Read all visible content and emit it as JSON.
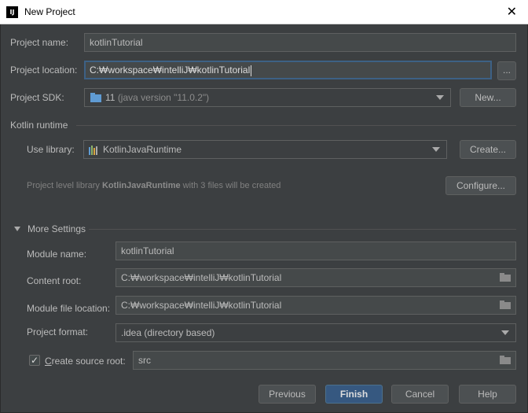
{
  "window": {
    "title": "New Project",
    "app_icon_text": "IJ"
  },
  "project": {
    "name_label": "Project name:",
    "name_value": "kotlinTutorial",
    "location_label": "Project location:",
    "location_value": "C:₩workspace₩intelliJ₩kotlinTutorial",
    "browse_label": "...",
    "sdk_label": "Project SDK:",
    "sdk_version": "11",
    "sdk_detail": "(java version \"11.0.2\")",
    "new_label": "New..."
  },
  "kotlin": {
    "section_label": "Kotlin runtime",
    "use_library_label": "Use library:",
    "library_value": "KotlinJavaRuntime",
    "create_label": "Create...",
    "info_prefix": "Project level library ",
    "info_library": "KotlinJavaRuntime",
    "info_suffix": " with 3 files will be created",
    "configure_label": "Configure..."
  },
  "more_settings": {
    "section_label": "More Settings",
    "module_name_label": "Module name:",
    "module_name_value": "kotlinTutorial",
    "content_root_label": "Content root:",
    "content_root_value": "C:₩workspace₩intelliJ₩kotlinTutorial",
    "module_file_label": "Module file location:",
    "module_file_value": "C:₩workspace₩intelliJ₩kotlinTutorial",
    "format_label": "Project format:",
    "format_value": ".idea (directory based)",
    "create_source_label": "Create source root:",
    "create_source_checked": true,
    "source_root_value": "src"
  },
  "footer": {
    "previous_label": "Previous",
    "finish_label": "Finish",
    "cancel_label": "Cancel",
    "help_label": "Help"
  },
  "colors": {
    "background": "#3c3f41",
    "primary_button": "#365880",
    "focus_border": "#3d6185",
    "sdk_icon": "#5f9bd3"
  }
}
